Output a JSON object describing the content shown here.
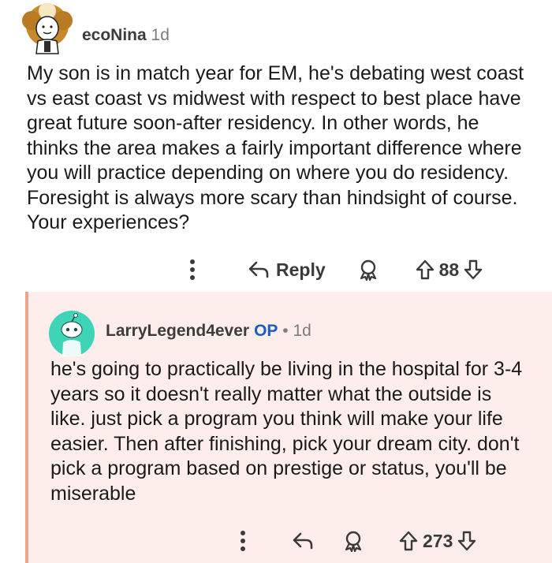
{
  "comments": [
    {
      "author": "ecoNina",
      "age": "1d",
      "body": "My son is in match year for EM, he's debating west coast vs east coast vs midwest with respect to best place have great future soon-after residency. In other words, he thinks the area makes a fairly important difference where you will practice depending on where you do residency. Foresight is always more scary than hindsight of course. Your experiences?",
      "reply_label": "Reply",
      "votes": "88"
    },
    {
      "author": "LarryLegend4ever",
      "op_badge": "OP",
      "separator": "•",
      "age": "1d",
      "body": "he's going to practically be living in the hospital for 3-4 years so it doesn't really matter what the outside is like. just pick a program you think will make your life easier. Then after finishing, pick your dream city. don't pick a program based on prestige or status, you'll be miserable",
      "votes": "273"
    }
  ],
  "colors": {
    "reply_background": "#fdeeeb",
    "thread_line": "#f1a48c",
    "op_badge": "#1c5dc4",
    "avatar2_background": "#3fd3b8"
  },
  "icons": [
    "more-icon",
    "reply-icon",
    "award-icon",
    "upvote-icon",
    "downvote-icon"
  ]
}
